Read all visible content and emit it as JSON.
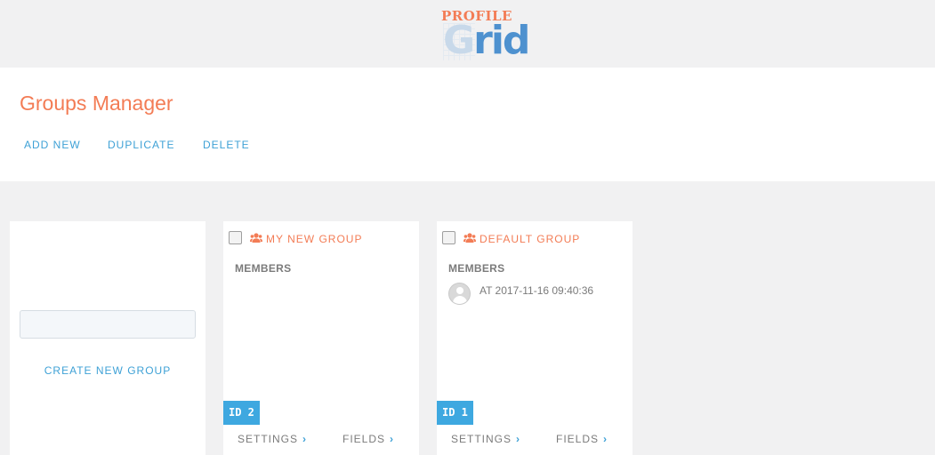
{
  "logo": {
    "top_text": "PROFILE",
    "main_text_g": "G",
    "main_text_rest": "rid"
  },
  "header": {
    "title": "Groups Manager",
    "actions": [
      "ADD NEW",
      "DUPLICATE",
      "DELETE"
    ]
  },
  "create": {
    "input_placeholder": "",
    "link_label": "CREATE NEW GROUP"
  },
  "groups": [
    {
      "name": "MY NEW GROUP",
      "members_label": "MEMBERS",
      "members": [],
      "id_label": "ID 2",
      "settings_label": "SETTINGS",
      "fields_label": "FIELDS",
      "chevron": "›"
    },
    {
      "name": "DEFAULT GROUP",
      "members_label": "MEMBERS",
      "members": [
        {
          "text": "AT 2017-11-16 09:40:36"
        }
      ],
      "id_label": "ID 1",
      "settings_label": "SETTINGS",
      "fields_label": "FIELDS",
      "chevron": "›"
    }
  ],
  "colors": {
    "accent_orange": "#f37c55",
    "accent_blue": "#3ea1d6",
    "badge_blue": "#3ea8e0"
  },
  "icons": {
    "group_icon": "users-icon",
    "member_avatar": "avatar-icon"
  }
}
